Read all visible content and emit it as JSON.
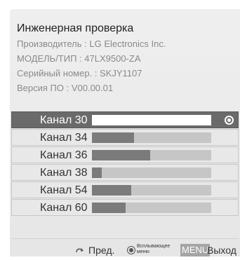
{
  "info": {
    "title": "Инженерная проверка",
    "manufacturer": "Производитель : LG Electronics Inc.",
    "model": "МОДЕЛЬ/ТИП : 47LX9500-ZA",
    "serial": "Серийный номер. : SKJY1107",
    "version": "Версия ПО : V00.00.01"
  },
  "channels": [
    {
      "label": "Канал 30",
      "level": 0.0,
      "selected": true
    },
    {
      "label": "Канал 34",
      "level": 0.35,
      "selected": false
    },
    {
      "label": "Канал 36",
      "level": 0.49,
      "selected": false
    },
    {
      "label": "Канал 38",
      "level": 0.08,
      "selected": false
    },
    {
      "label": "Канал 54",
      "level": 0.33,
      "selected": false
    },
    {
      "label": "Канал 60",
      "level": 0.28,
      "selected": false
    }
  ],
  "footer": {
    "back_label": "Пред.",
    "popup_label": "Всплывающее меню",
    "menu_key": "MENU",
    "exit_label": "Выход"
  },
  "icons": {
    "back": "back-arrow-icon",
    "ok": "ok-button-icon",
    "radio": "radio-selected-icon"
  }
}
